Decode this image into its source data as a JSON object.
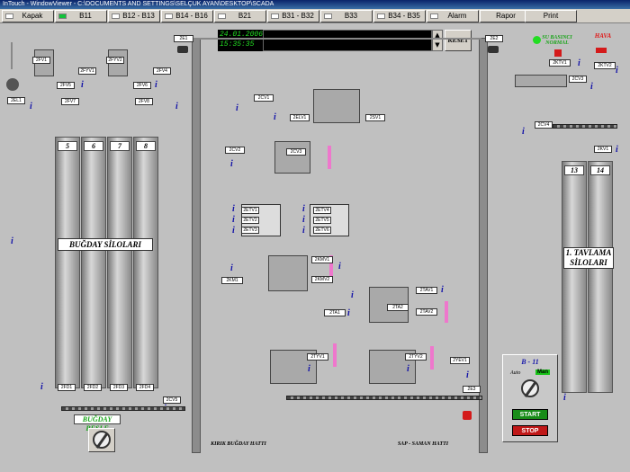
{
  "window": {
    "title": "InTouch - WindowViewer - C:\\DOCUMENTS AND SETTINGS\\SELÇUK AYAN\\DESKTOP\\SCADA"
  },
  "nav": [
    {
      "label": "Kapak",
      "indicator": "off"
    },
    {
      "label": "B11",
      "indicator": "on"
    },
    {
      "label": "B12 - B13",
      "indicator": "off"
    },
    {
      "label": "B14 - B16",
      "indicator": "off"
    },
    {
      "label": "B21",
      "indicator": "off"
    },
    {
      "label": "B31 - B32",
      "indicator": "off"
    },
    {
      "label": "B33",
      "indicator": "off"
    },
    {
      "label": "B34 - B35",
      "indicator": "off"
    },
    {
      "label": "Alarm",
      "indicator": "off"
    },
    {
      "label": "Rapor",
      "indicator": null
    },
    {
      "label": "Print",
      "indicator": null
    }
  ],
  "header": {
    "date": "24.01.2006",
    "time": "15:35:35",
    "reset_label": "RESET",
    "scroll_up": "▲",
    "scroll_down": "▼"
  },
  "silos": {
    "left_numbers": [
      "5",
      "6",
      "7",
      "8"
    ],
    "left_label": "BUĞDAY SİLOLARI",
    "right_numbers": [
      "13",
      "14"
    ],
    "right_label": "1. TAVLAMA SİLOLARI"
  },
  "status": {
    "water_pressure": "SU BASINCI NORMAL",
    "air": "HAVA"
  },
  "besle_label": "BUĞDAY BESLE",
  "captions": {
    "kirik": "KIRIK BUĞDAY HATTI",
    "sap": "SAP - SAMAN HATTI"
  },
  "control": {
    "title": "B - 11",
    "auto": "Auto",
    "man": "Man",
    "start": "START",
    "stop": "STOP"
  },
  "tags": {
    "t1": "2EL1",
    "t2": "2E2",
    "t3": "2FYV1",
    "t4": "2FV4",
    "t5": "2FV5",
    "t6": "2FYV2",
    "t7": "2FV6",
    "t8": "2FV7",
    "t9": "2FV8",
    "t10": "2E1",
    "t11": "2CV1",
    "t12": "2ELV1",
    "t13": "2CV2",
    "t14": "2CV3",
    "t15": "2HV1",
    "t16": "2SV1",
    "t17": "2CV3",
    "t18": "2ELV2",
    "t19": "2ETV1",
    "t20": "2ETV2",
    "t21": "2ETV3",
    "t22": "2ETV4",
    "t23": "2ETV5",
    "t24": "2ETV6",
    "t25": "2KM1",
    "t26": "2KM2",
    "t27": "2KMV1",
    "t28": "2KMV2",
    "t29": "2TA1",
    "t30": "2TA2",
    "t31": "2TAV1",
    "t32": "2TAV2",
    "t33": "2TYV1",
    "t34": "2TYV2",
    "t35": "2YEV1",
    "t36": "2E3",
    "t37": "2FD1",
    "t38": "2FD2",
    "t39": "2FD3",
    "t40": "2FD4",
    "t41": "2CV5",
    "t42": "2E2",
    "t43": "2KTV1",
    "t44": "2KTV2",
    "t45": "2CV4",
    "t46": "2FV1",
    "t47": "2KV1"
  }
}
